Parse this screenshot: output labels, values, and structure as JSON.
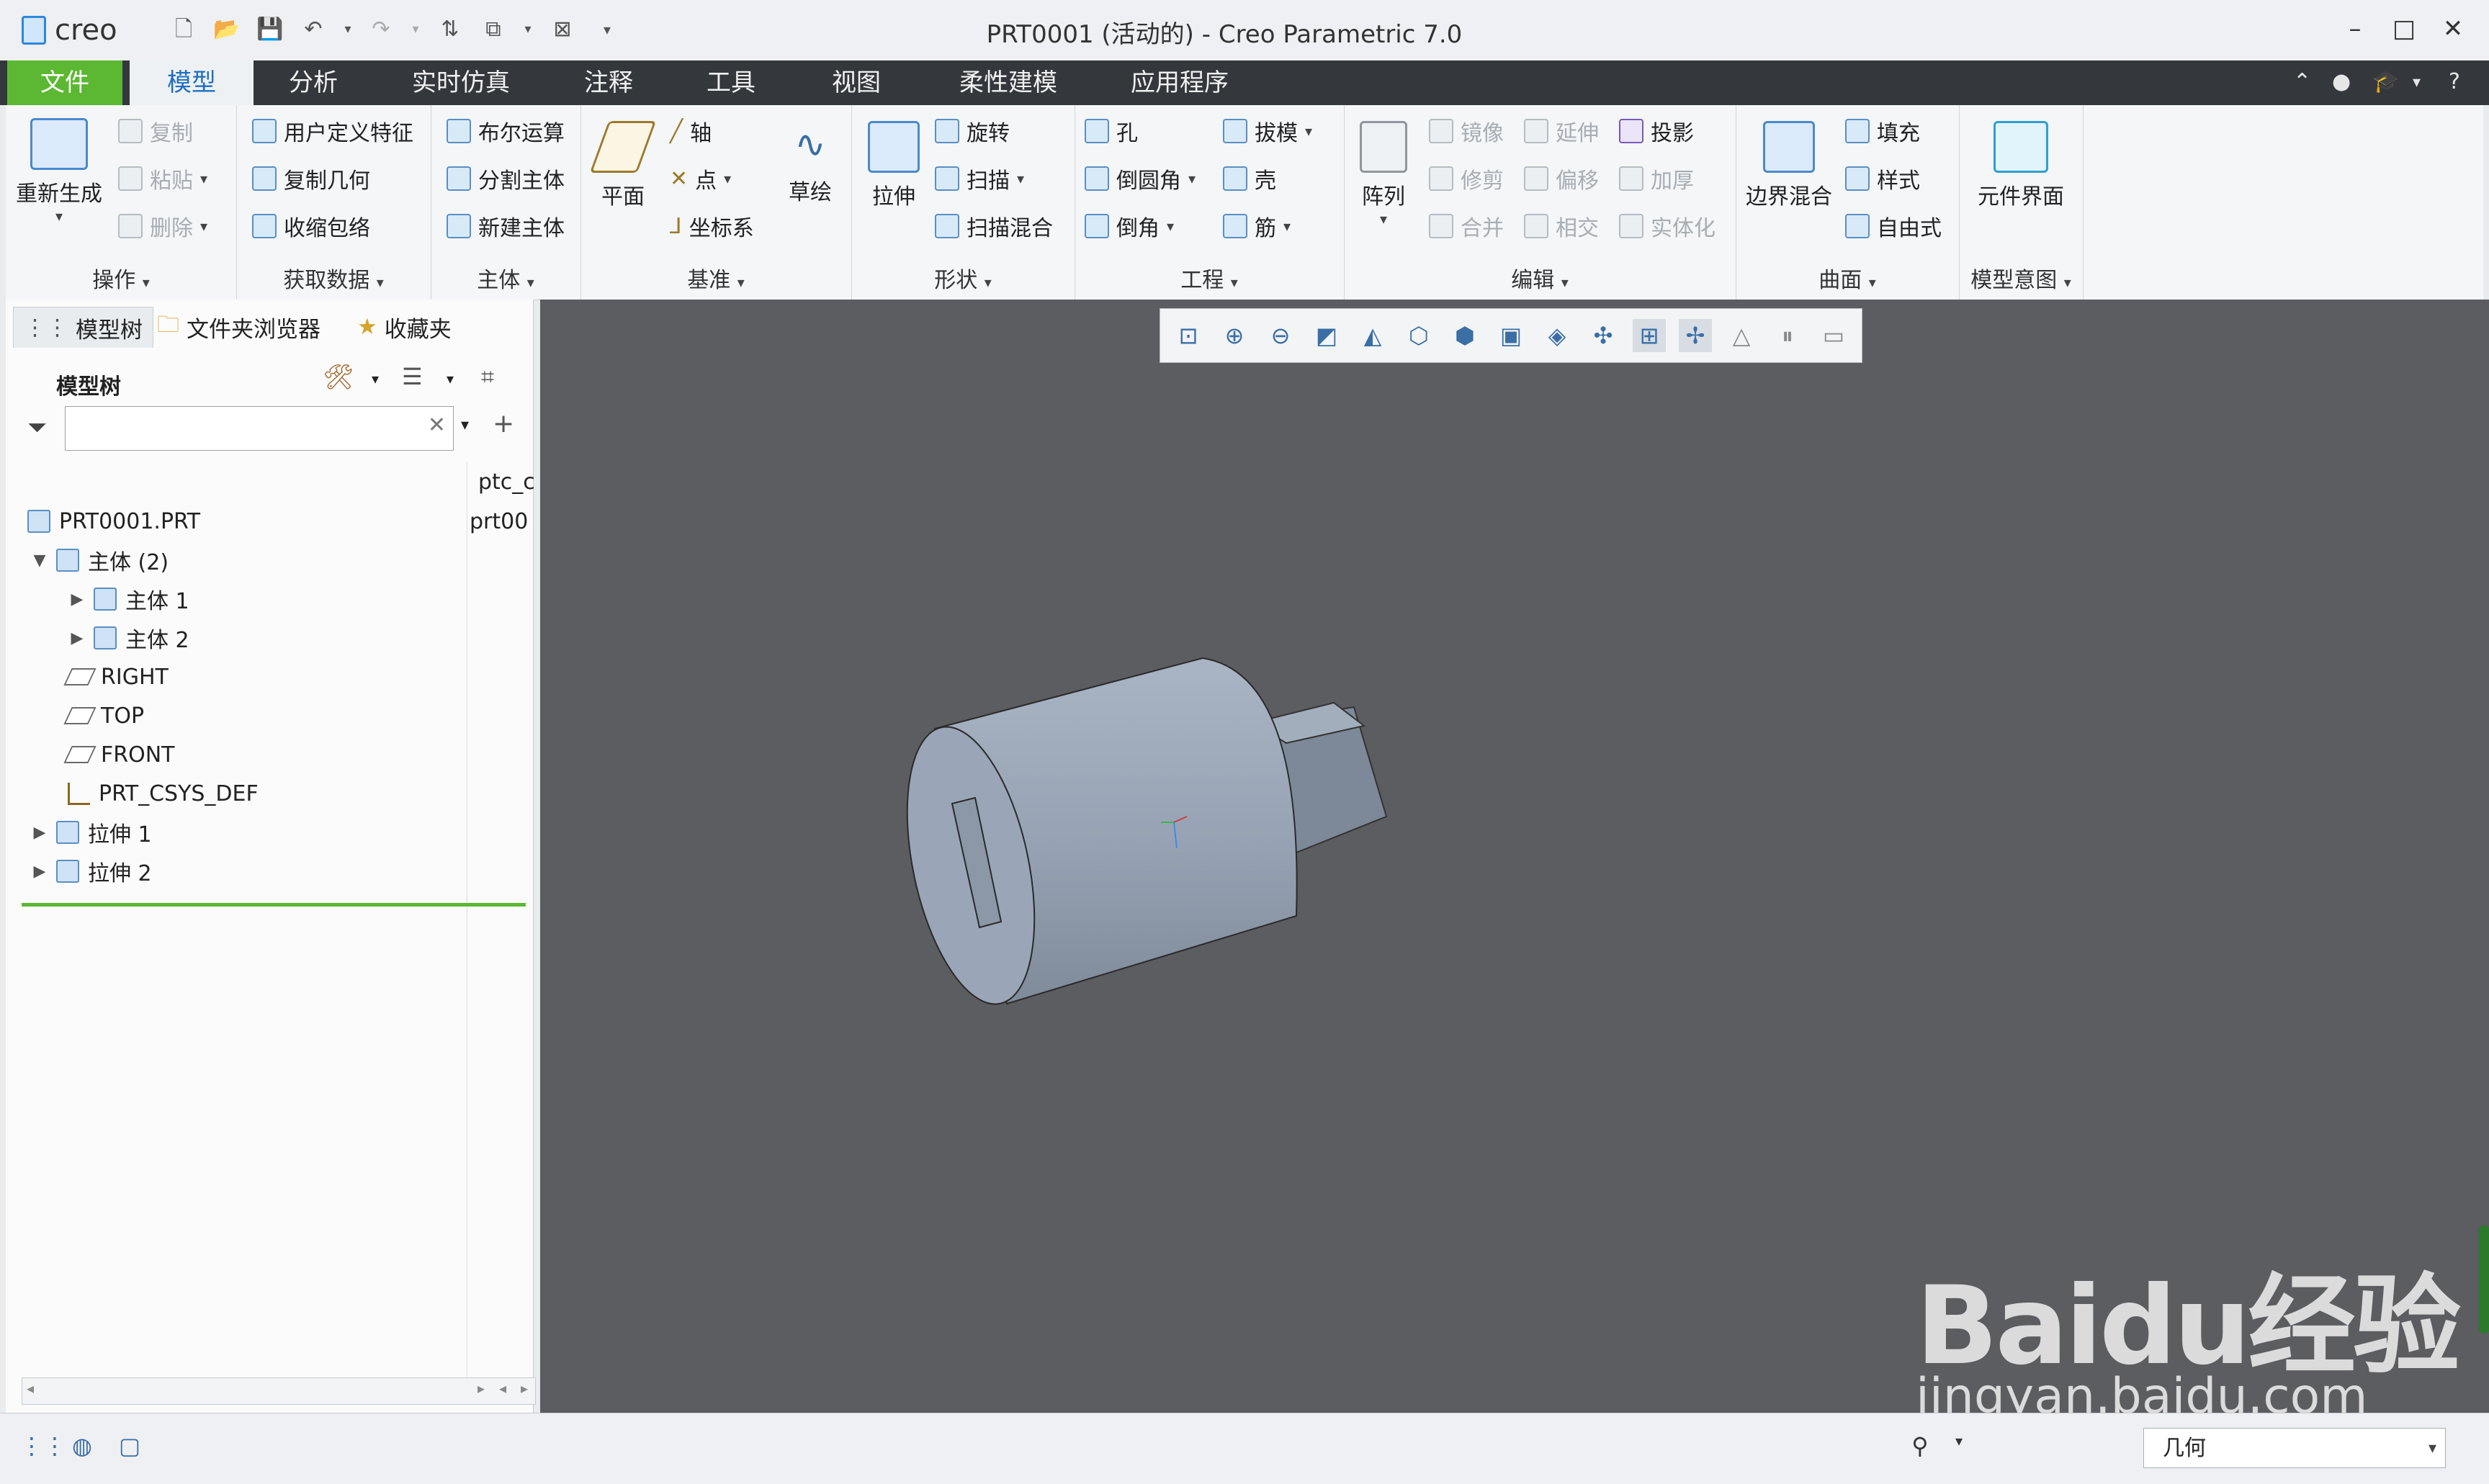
{
  "app": {
    "logo_text": "creo",
    "window_title": "PRT0001 (活动的) - Creo Parametric 7.0",
    "minimize": "–",
    "maximize": "□",
    "close": "✕"
  },
  "ribbon_tabs": [
    "文件",
    "模型",
    "分析",
    "实时仿真",
    "注释",
    "工具",
    "视图",
    "柔性建模",
    "应用程序"
  ],
  "active_tab": "模型",
  "ribbon": {
    "operations": {
      "label": "操作",
      "regenerate": "重新生成",
      "copy": "复制",
      "paste": "粘贴",
      "delete": "删除"
    },
    "get_data": {
      "label": "获取数据",
      "udf": "用户定义特征",
      "copy_geom": "复制几何",
      "shrinkwrap": "收缩包络"
    },
    "body": {
      "label": "主体",
      "boolean": "布尔运算",
      "split_body": "分割主体",
      "new_body": "新建主体"
    },
    "datum": {
      "label": "基准",
      "plane": "平面",
      "axis": "轴",
      "point": "点",
      "csys": "坐标系",
      "sketch": "草绘"
    },
    "shapes": {
      "label": "形状",
      "extrude": "拉伸",
      "revolve": "旋转",
      "sweep": "扫描",
      "swept_blend": "扫描混合"
    },
    "engineering": {
      "label": "工程",
      "hole": "孔",
      "round": "倒圆角",
      "chamfer": "倒角",
      "draft": "拔模",
      "shell": "壳",
      "rib": "筋"
    },
    "editing": {
      "label": "编辑",
      "pattern": "阵列",
      "mirror": "镜像",
      "extend": "延伸",
      "project": "投影",
      "trim": "修剪",
      "offset": "偏移",
      "thicken": "加厚",
      "merge": "合并",
      "intersect": "相交",
      "solidify": "实体化"
    },
    "surfaces": {
      "label": "曲面",
      "boundary_blend": "边界混合",
      "fill": "填充",
      "style": "样式",
      "freestyle": "自由式"
    },
    "model_intent": {
      "label": "模型意图",
      "component_interface": "元件界面"
    }
  },
  "left_panel": {
    "tabs": [
      "模型树",
      "文件夹浏览器",
      "收藏夹"
    ],
    "tree_header": "模型树",
    "search_placeholder": "",
    "column_header": "ptc_c",
    "items": [
      {
        "label": "PRT0001.PRT",
        "col": "prt00"
      },
      {
        "label": "主体 (2)",
        "col": ""
      },
      {
        "label": "主体 1",
        "col": ""
      },
      {
        "label": "主体 2",
        "col": ""
      },
      {
        "label": "RIGHT",
        "col": ""
      },
      {
        "label": "TOP",
        "col": ""
      },
      {
        "label": "FRONT",
        "col": ""
      },
      {
        "label": "PRT_CSYS_DEF",
        "col": ""
      },
      {
        "label": "拉伸 1",
        "col": ""
      },
      {
        "label": "拉伸 2",
        "col": ""
      }
    ]
  },
  "status": {
    "selection_filter": "几何"
  },
  "watermark": {
    "brand": "Baidu经验",
    "url": "jingyan.baidu.com"
  },
  "colors": {
    "accent_green": "#5cb832",
    "tab_bar": "#34383c",
    "graphics_bg": "#5b5d60",
    "model_color": "#9aa5b5"
  }
}
